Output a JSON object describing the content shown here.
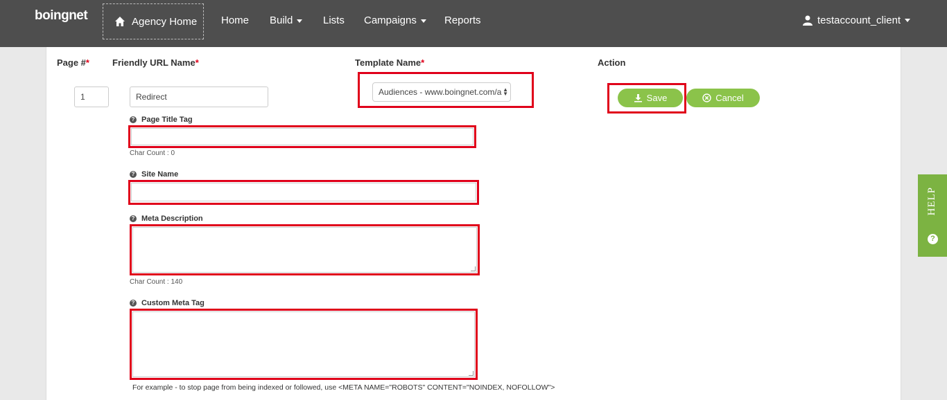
{
  "navbar": {
    "logo_text": "boingnet",
    "agency_home": "Agency Home",
    "links": [
      {
        "label": "Home"
      },
      {
        "label": "Build"
      },
      {
        "label": "Lists"
      },
      {
        "label": "Campaigns"
      },
      {
        "label": "Reports"
      }
    ],
    "user": "testaccount_client"
  },
  "table_headers": {
    "page_num": "Page #",
    "friendly_url": "Friendly URL Name",
    "template_name": "Template Name",
    "action": "Action",
    "required_mark": "*"
  },
  "row": {
    "page_num": "1",
    "friendly_url": "Redirect",
    "template_value": "Audiences - www.boingnet.com/a"
  },
  "fields": {
    "page_title_tag": {
      "label": "Page Title Tag",
      "value": "",
      "char_count": "Char Count : 0"
    },
    "site_name": {
      "label": "Site Name",
      "value": ""
    },
    "meta_description": {
      "label": "Meta Description",
      "value": "",
      "char_count": "Char Count : 140"
    },
    "custom_meta_tag": {
      "label": "Custom Meta Tag",
      "value": ""
    }
  },
  "actions": {
    "save": "Save",
    "cancel": "Cancel"
  },
  "example_text": "For example - to stop page from being indexed or followed, use <META NAME=\"ROBOTS\" CONTENT=\"NOINDEX, NOFOLLOW\">",
  "help_tab": "HELP",
  "colors": {
    "navbar_bg": "#4e4e4e",
    "button_green": "#8bc34a",
    "highlight_red": "#e0001a",
    "help_green": "#7cb342"
  }
}
